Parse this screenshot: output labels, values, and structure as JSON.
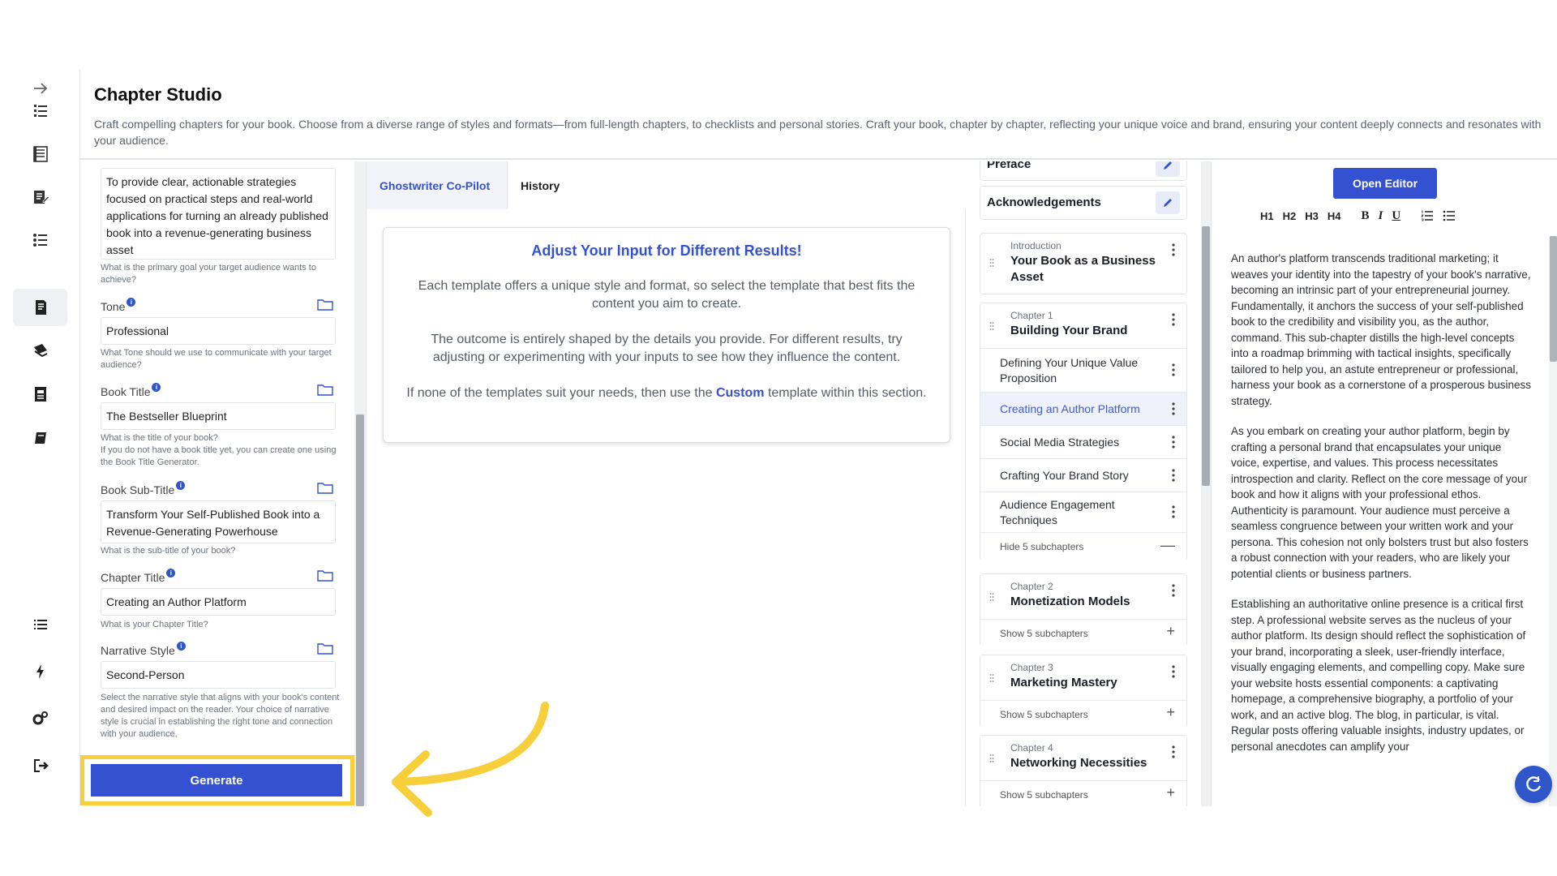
{
  "header": {
    "title": "Chapter Studio",
    "description": "Craft compelling chapters for your book. Choose from a diverse range of styles and formats—from full-length chapters, to checklists and personal stories. Craft your book, chapter by chapter, reflecting your unique voice and brand, ensuring your content deeply connects and resonates with your audience."
  },
  "form": {
    "goal_value": "To provide clear, actionable strategies focused on practical steps and real-world applications for turning an already published book into a revenue-generating business asset",
    "goal_hint": "What is the primary goal your target audience wants to achieve?",
    "tone_label": "Tone",
    "tone_value": "Professional",
    "tone_hint": "What Tone should we use to communicate with your target audience?",
    "book_title_label": "Book Title",
    "book_title_value": "The Bestseller Blueprint",
    "book_title_hint": "What is the title of your book?\nIf you do not have a book title yet, you can create one using the Book Title Generator.",
    "subtitle_label": "Book Sub-Title",
    "subtitle_value": "Transform Your Self-Published Book into a Revenue-Generating Powerhouse",
    "subtitle_hint": "What is the sub-title of your book?",
    "chapter_title_label": "Chapter Title",
    "chapter_title_value": "Creating an Author Platform",
    "chapter_title_hint": "What is your Chapter Title?",
    "narrative_label": "Narrative Style",
    "narrative_value": "Second-Person",
    "narrative_hint": "Select the narrative style that aligns with your book's content and desired impact on the reader. Your choice of narrative style is crucial in establishing the right tone and connection with your audience.",
    "info_glyph": "i",
    "generate_label": "Generate"
  },
  "copilot": {
    "tab_copilot": "Ghostwriter Co-Pilot",
    "tab_history": "History",
    "notice_title": "Adjust Your Input for Different Results!",
    "notice_p1": "Each template offers a unique style and format, so select the template that best fits the content you aim to create.",
    "notice_p2": "The outcome is entirely shaped by the details you provide. For different results, try adjusting or experimenting with your inputs to see how they influence the content.",
    "notice_p3_pre": "If none of the templates suit your needs, then use the ",
    "notice_p3_link": "Custom",
    "notice_p3_post": " template within this section."
  },
  "outline": {
    "preface": "Preface",
    "acknowledgements": "Acknowledgements",
    "intro_kicker": "Introduction",
    "intro_title": "Your Book as a Business Asset",
    "ch1_kicker": "Chapter 1",
    "ch1_title": "Building Your Brand",
    "ch1_subs": [
      "Defining Your Unique Value Proposition",
      "Creating an Author Platform",
      "Social Media Strategies",
      "Crafting Your Brand Story",
      "Audience Engagement Techniques"
    ],
    "ch1_toggle": "Hide 5 subchapters",
    "ch2_kicker": "Chapter 2",
    "ch2_title": "Monetization Models",
    "ch2_toggle": "Show 5 subchapters",
    "ch3_kicker": "Chapter 3",
    "ch3_title": "Marketing Mastery",
    "ch3_toggle": "Show 5 subchapters",
    "ch4_kicker": "Chapter 4",
    "ch4_title": "Networking Necessities",
    "ch4_toggle": "Show 5 subchapters",
    "minus": "—",
    "plus": "+"
  },
  "editor": {
    "open_editor_label": "Open Editor",
    "toolbar": [
      "H1",
      "H2",
      "H3",
      "H4",
      "B",
      "I",
      "U"
    ],
    "paragraphs": [
      "An author's platform transcends traditional marketing; it weaves your identity into the tapestry of your book's narrative, becoming an intrinsic part of your entrepreneurial journey. Fundamentally, it anchors the success of your self-published book to the credibility and visibility you, as the author, command. This sub-chapter distills the high-level concepts into a roadmap brimming with tactical insights, specifically tailored to help you, an astute entrepreneur or professional, harness your book as a cornerstone of a prosperous business strategy.",
      "As you embark on creating your author platform, begin by crafting a personal brand that encapsulates your unique voice, expertise, and values. This process necessitates introspection and clarity. Reflect on the core message of your book and how it aligns with your professional ethos. Authenticity is paramount. Your audience must perceive a seamless congruence between your written work and your persona. This cohesion not only bolsters trust but also fosters a robust connection with your readers, who are likely your potential clients or business partners.",
      "Establishing an authoritative online presence is a critical first step. A professional website serves as the nucleus of your author platform. Its design should reflect the sophistication of your brand, incorporating a sleek, user-friendly interface, visually engaging elements, and compelling copy. Make sure your website hosts essential components: a captivating homepage, a comprehensive biography, a portfolio of your work, and an active blog. The blog, in particular, is vital. Regular posts offering valuable insights, industry updates, or personal anecdotes can amplify your"
    ]
  },
  "colors": {
    "accent": "#3451d1",
    "highlight": "#f7cf3a",
    "arrow": "#f7cf3a"
  }
}
